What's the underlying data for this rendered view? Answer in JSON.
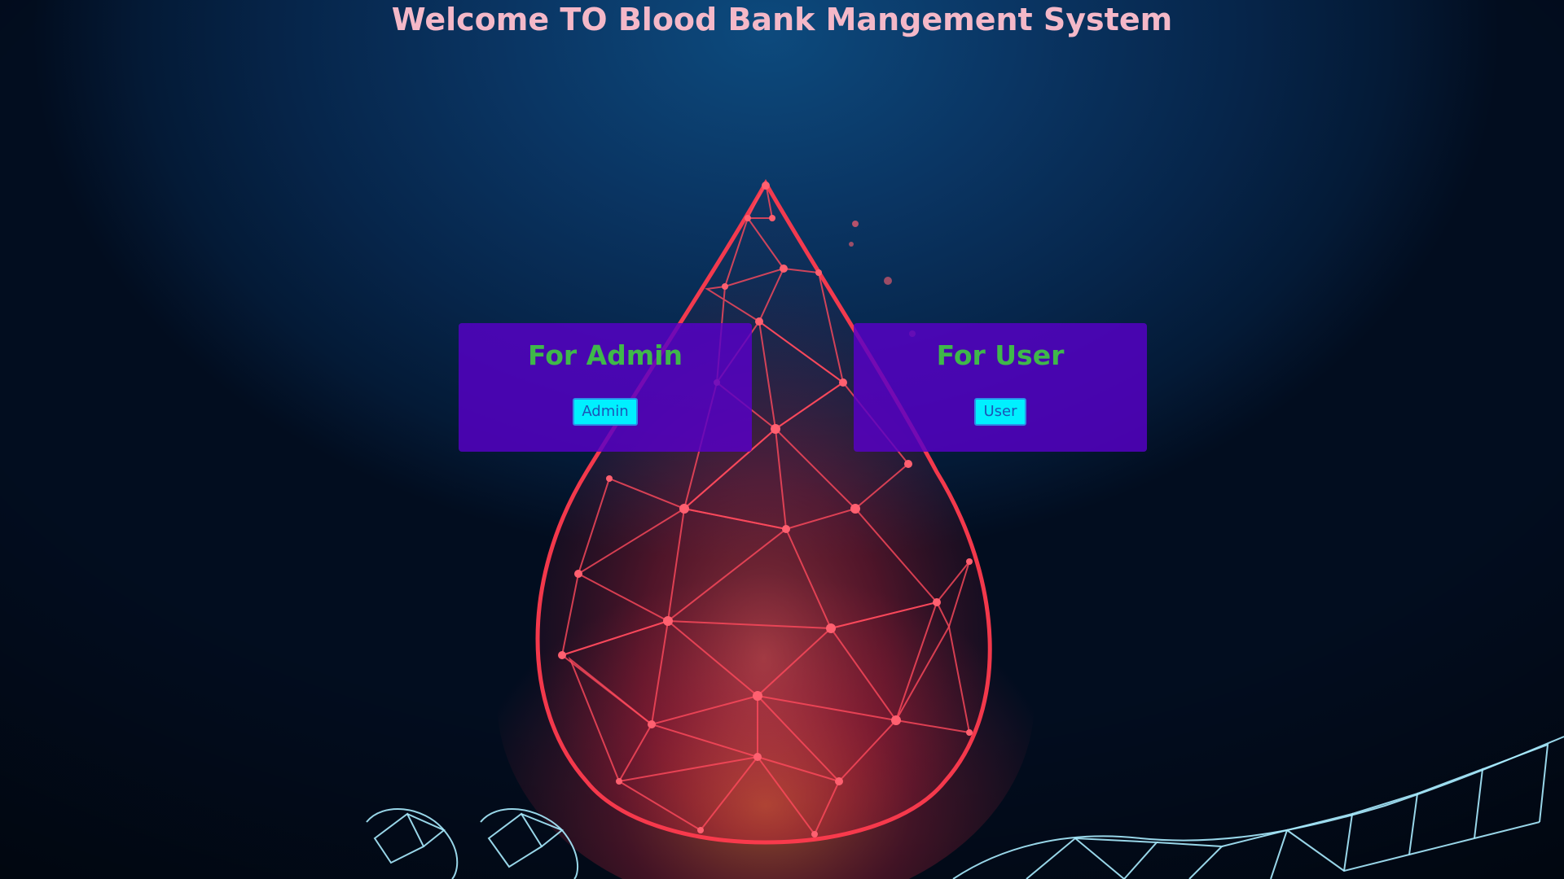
{
  "page": {
    "title": "Welcome TO Blood Bank Mangement System"
  },
  "admin_card": {
    "heading": "For Admin",
    "button_label": "Admin"
  },
  "user_card": {
    "heading": "For User",
    "button_label": "User"
  },
  "colors": {
    "title": "#f4b8c8",
    "card_background": "#5800c8",
    "card_heading": "#3fb84a",
    "button_background": "#00f0ff",
    "button_text": "#1b56b8",
    "background_dark": "#041a36",
    "drop_accent": "#ff3b4e",
    "hand_accent": "#9ee8ff"
  }
}
